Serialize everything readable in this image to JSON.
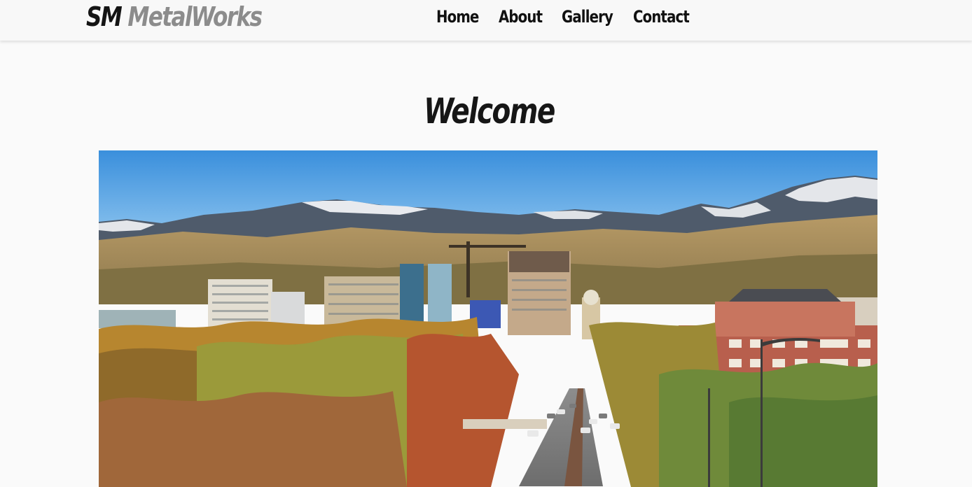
{
  "brand": {
    "part1": "SM",
    "part2": "MetalWorks"
  },
  "nav": {
    "items": [
      {
        "label": "Home"
      },
      {
        "label": "About"
      },
      {
        "label": "Gallery"
      },
      {
        "label": "Contact"
      }
    ]
  },
  "main": {
    "heading": "Welcome"
  },
  "colors": {
    "brand_primary": "#141414",
    "brand_secondary": "#8c8c8c",
    "nav_background": "#f8f8f8",
    "page_background": "#fafafa"
  },
  "icons": {
    "hero_image": "city-skyline-with-mountains-image"
  }
}
